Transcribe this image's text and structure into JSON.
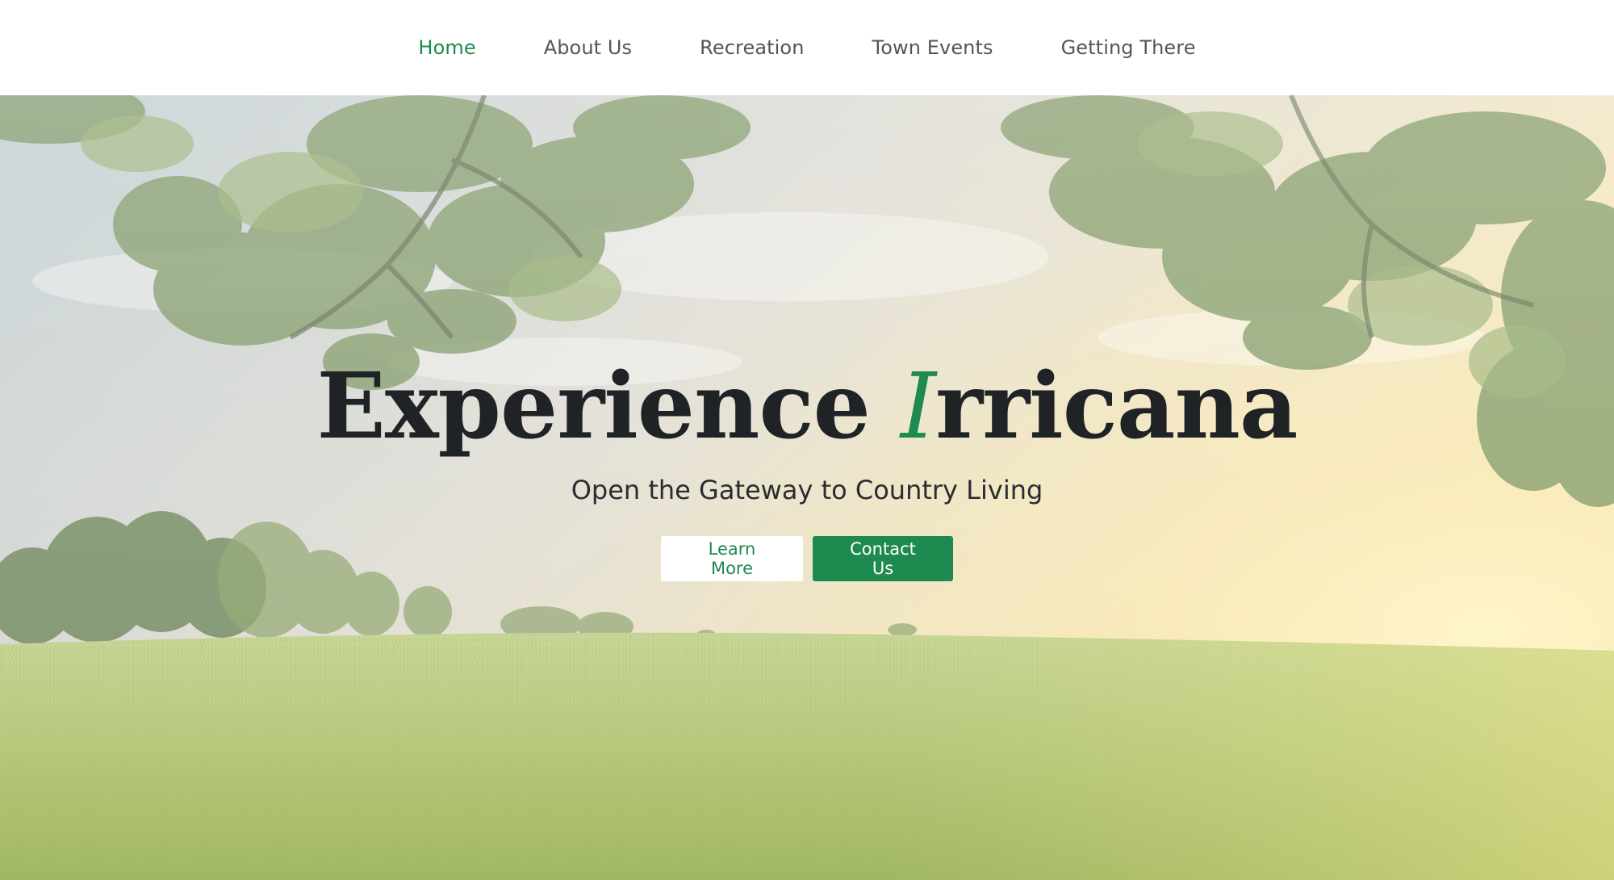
{
  "nav": {
    "items": [
      {
        "label": "Home",
        "active": true
      },
      {
        "label": "About Us",
        "active": false
      },
      {
        "label": "Recreation",
        "active": false
      },
      {
        "label": "Town Events",
        "active": false
      },
      {
        "label": "Getting There",
        "active": false
      }
    ]
  },
  "hero": {
    "title_before": "Experience ",
    "title_accent": "I",
    "title_after": "rricana",
    "subtitle": "Open the Gateway to Country Living",
    "buttons": {
      "learn_more": "Learn More",
      "contact_us": "Contact Us"
    }
  },
  "colors": {
    "accent": "#1e8a4f",
    "nav_text": "#555555",
    "title_text": "#1f2326"
  }
}
